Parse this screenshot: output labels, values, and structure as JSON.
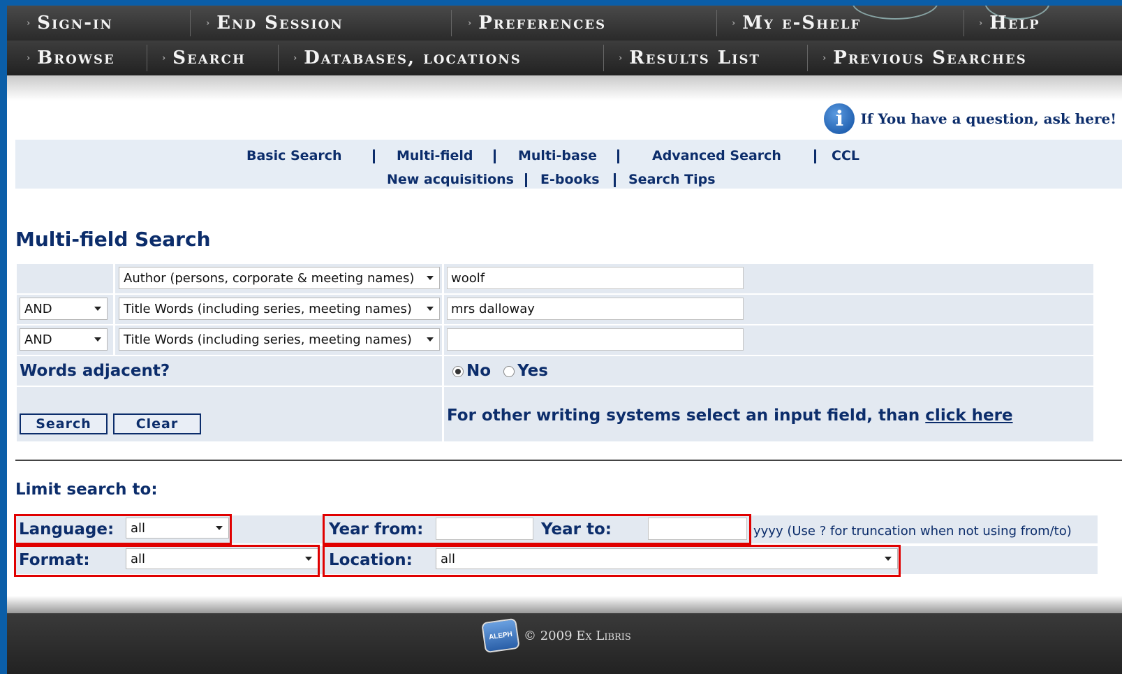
{
  "nav": {
    "row1": [
      "Sign-in",
      "End Session",
      "Preferences",
      "My e-Shelf",
      "Help"
    ],
    "row2": [
      "Browse",
      "Search",
      "Databases, locations",
      "Results List",
      "Previous Searches"
    ]
  },
  "info_text": "If You have a question, ask here!",
  "subnav": {
    "row1": [
      "Basic Search",
      "Multi-field",
      "Multi-base",
      "Advanced Search",
      "CCL"
    ],
    "row2": [
      "New acquisitions",
      "E-books",
      "Search Tips"
    ]
  },
  "page_title": "Multi-field Search",
  "rows": [
    {
      "op": "",
      "field": "Author (persons, corporate & meeting names)",
      "value": "woolf"
    },
    {
      "op": "AND",
      "field": "Title Words (including series, meeting names)",
      "value": "mrs dalloway"
    },
    {
      "op": "AND",
      "field": "Title Words (including series, meeting names)",
      "value": ""
    }
  ],
  "adjacent": {
    "label": "Words adjacent?",
    "no": "No",
    "yes": "Yes",
    "selected": "No"
  },
  "buttons": {
    "search": "Search",
    "clear": "Clear"
  },
  "other_writing": {
    "text": "For other writing systems select an input field, than ",
    "link": "click here"
  },
  "limit_title": "Limit search to:",
  "limits": {
    "language_label": "Language:",
    "language_value": "all",
    "year_from_label": "Year from:",
    "year_from_value": "",
    "year_to_label": "Year to:",
    "year_to_value": "",
    "year_hint": "yyyy (Use ? for truncation when not using from/to)",
    "format_label": "Format:",
    "format_value": "all",
    "location_label": "Location:",
    "location_value": "all"
  },
  "footer": {
    "logo_text": "ALEPH",
    "copyright": "© 2009 Ex Libris"
  },
  "colors": {
    "frame": "#0b5ea8",
    "text": "#0c2d6b",
    "highlight": "#e00000"
  }
}
